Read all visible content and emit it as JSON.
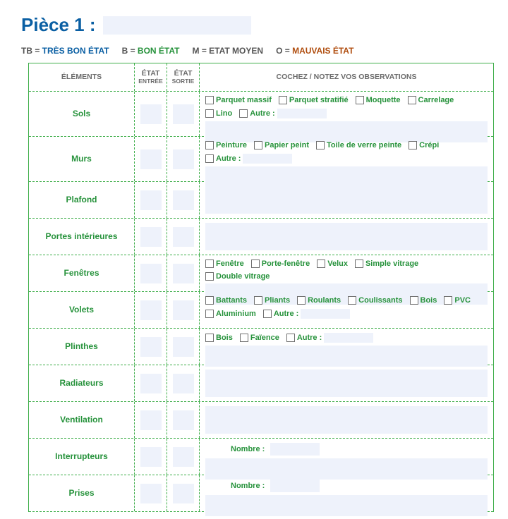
{
  "title": "Pièce 1 :",
  "legend": [
    {
      "key": "TB =",
      "value": "TRÈS BON ÉTAT",
      "cls": "lv1"
    },
    {
      "key": "B =",
      "value": "BON ÉTAT",
      "cls": "lv2"
    },
    {
      "key": "M =",
      "value": "ETAT MOYEN",
      "cls": "lv3"
    },
    {
      "key": "O =",
      "value": "MAUVAIS ÉTAT",
      "cls": "lv4"
    }
  ],
  "headers": {
    "elements": "ÉLÉMENTS",
    "etat": "ÉTAT",
    "entree": "ENTRÉE",
    "sortie": "SORTIE",
    "obs": "COCHEZ / NOTEZ VOS OBSERVATIONS"
  },
  "rows": [
    {
      "label": "Sols",
      "h": "h2",
      "checks": [
        "Parquet massif",
        "Parquet stratifié",
        "Moquette",
        "Carrelage",
        "Lino",
        "Autre :"
      ],
      "obs_box": true,
      "autre_input": true
    },
    {
      "label": "Murs",
      "h": "h2",
      "checks": [
        "Peinture",
        "Papier peint",
        "Toile de verre peinte",
        "Crépi",
        "Autre :"
      ],
      "obs_box": true,
      "autre_input": true
    },
    {
      "label": "Plafond",
      "h": "h1",
      "checks": [],
      "obs_box": true
    },
    {
      "label": "Portes intérieures",
      "h": "h1",
      "checks": [],
      "obs_box": true
    },
    {
      "label": "Fenêtres",
      "h": "h1",
      "checks": [
        "Fenêtre",
        "Porte-fenêtre",
        "Velux",
        "Simple vitrage",
        "Double vitrage"
      ],
      "obs_box": true
    },
    {
      "label": "Volets",
      "h": "h1",
      "checks": [
        "Battants",
        "Pliants",
        "Roulants",
        "Coulissants",
        "Bois",
        "PVC",
        "Aluminium",
        "Autre :"
      ],
      "obs_box": false,
      "autre_input": true
    },
    {
      "label": "Plinthes",
      "h": "h1",
      "checks": [
        "Bois",
        "Faïence",
        "Autre :"
      ],
      "obs_box": true,
      "autre_input": true
    },
    {
      "label": "Radiateurs",
      "h": "h1",
      "checks": [],
      "obs_box": true
    },
    {
      "label": "Ventilation",
      "h": "h1",
      "checks": [],
      "obs_box": true
    },
    {
      "label": "Interrupteurs",
      "h": "h1",
      "checks": [],
      "obs_box": true,
      "nombre": true
    },
    {
      "label": "Prises",
      "h": "h1",
      "checks": [],
      "obs_box": true,
      "nombre": true
    }
  ],
  "labels": {
    "nombre": "Nombre :"
  }
}
